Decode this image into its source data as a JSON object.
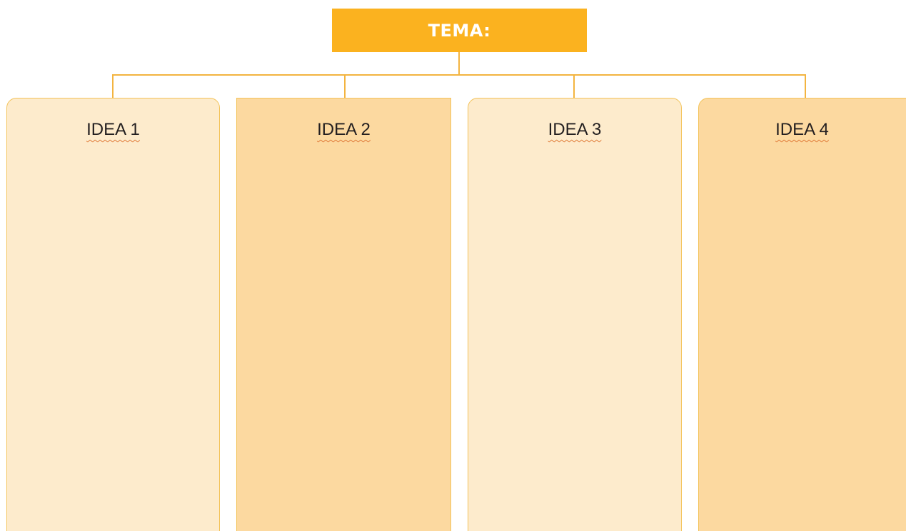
{
  "topic": {
    "label": "TEMA:"
  },
  "ideas": [
    {
      "label": "IDEA 1"
    },
    {
      "label": "IDEA 2"
    },
    {
      "label": "IDEA 3"
    },
    {
      "label": "IDEA 4"
    }
  ],
  "colors": {
    "topic_fill": "#fbb21f",
    "connector": "#f3b440",
    "column_light": "#fdebcc",
    "column_dark": "#fcd9a0",
    "column_border": "#f3c35a",
    "text": "#231f20",
    "spellcheck_underline": "#e07b39"
  }
}
